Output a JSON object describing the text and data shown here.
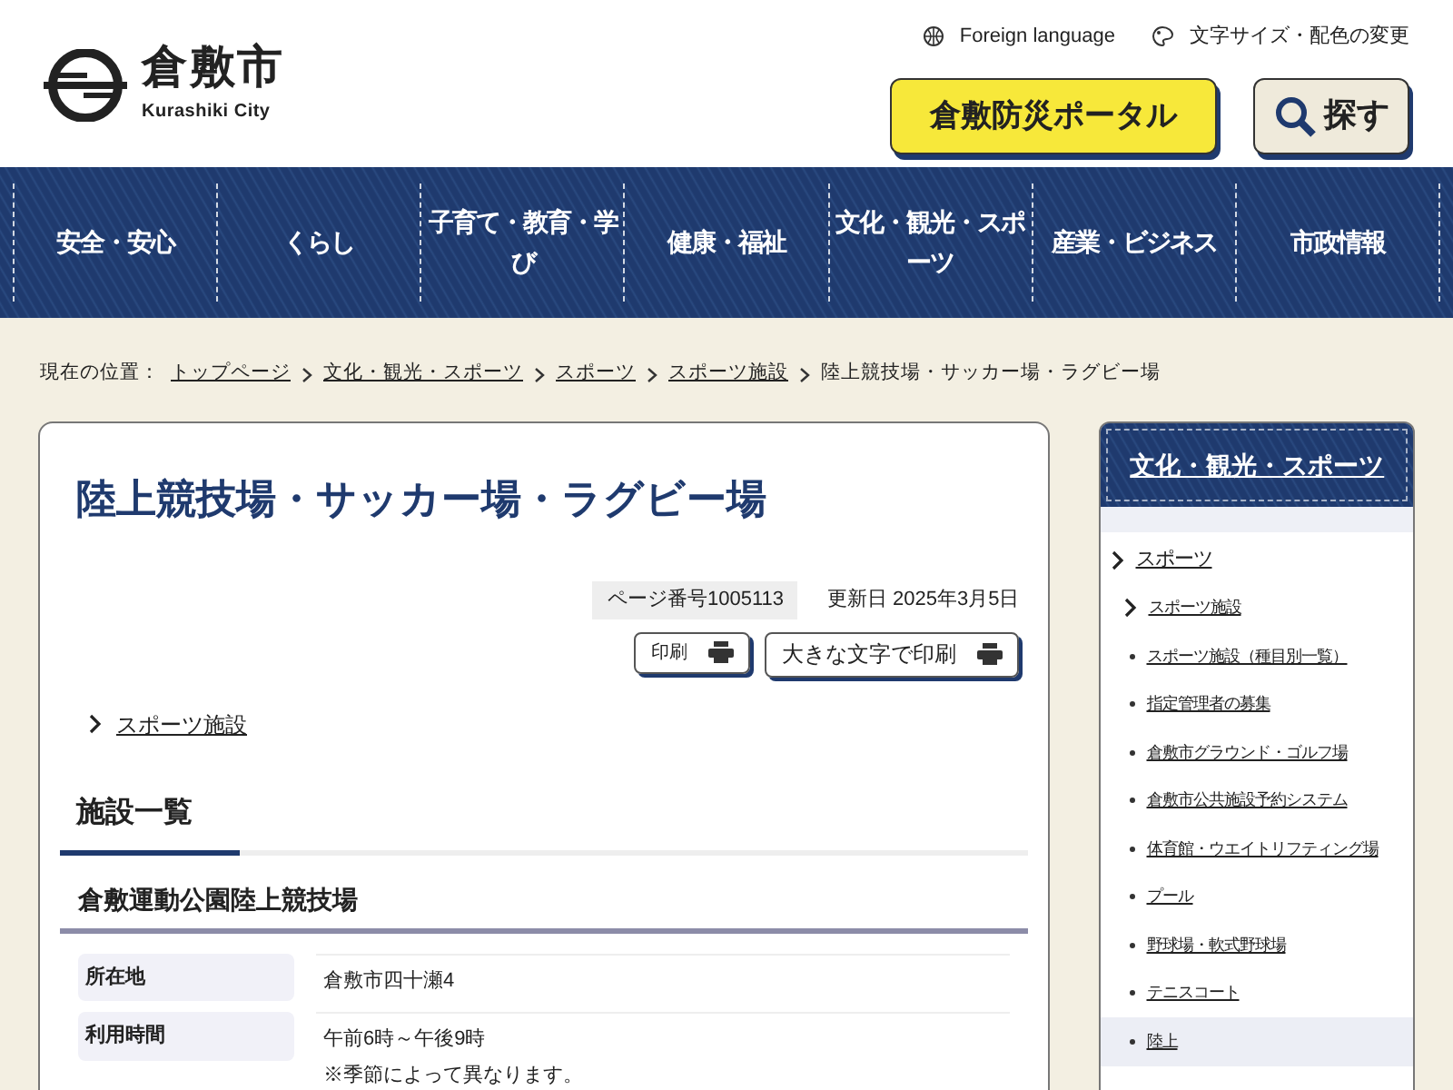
{
  "header": {
    "logo_name": "倉敷市",
    "logo_subtitle": "Kurashiki City",
    "links": [
      {
        "kind": "globe",
        "label": "Foreign language"
      },
      {
        "kind": "palette",
        "label": "文字サイズ・配色の変更"
      }
    ],
    "disaster_button": "倉敷防災ポータル",
    "search_button": "探す"
  },
  "nav": [
    "安全・安心",
    "くらし",
    "子育て・教育・学び",
    "健康・福祉",
    "文化・観光・スポーツ",
    "産業・ビジネス",
    "市政情報"
  ],
  "breadcrumb": {
    "label": "現在の位置：",
    "links": [
      "トップページ",
      "文化・観光・スポーツ",
      "スポーツ",
      "スポーツ施設"
    ],
    "current": "陸上競技場・サッカー場・ラグビー場"
  },
  "article": {
    "title": "陸上競技場・サッカー場・ラグビー場",
    "page_number": "ページ番号1005113",
    "updated": "更新日 2025年3月5日",
    "print_button": "印刷",
    "large_print_button": "大きな文字で印刷",
    "parent_link": "スポーツ施設",
    "section_heading": "施設一覧",
    "facility_heading": "倉敷運動公園陸上競技場",
    "table": [
      {
        "label": "所在地",
        "lines": [
          "倉敷市四十瀬4"
        ]
      },
      {
        "label": "利用時間",
        "lines": [
          "午前6時～午後9時",
          "※季節によって異なります。"
        ]
      }
    ]
  },
  "sidebar": {
    "title": "文化・観光・スポーツ",
    "items": [
      {
        "label": "スポーツ",
        "selected": false,
        "children": [
          {
            "label": "スポーツ施設",
            "selected": false,
            "children": [
              {
                "label": "スポーツ施設（種目別一覧）",
                "selected": false
              },
              {
                "label": "指定管理者の募集",
                "selected": false
              },
              {
                "label": "倉敷市グラウンド・ゴルフ場",
                "selected": false
              },
              {
                "label": "倉敷市公共施設予約システム",
                "selected": false
              },
              {
                "label": "体育館・ウエイトリフティング場",
                "selected": false
              },
              {
                "label": "プール",
                "selected": false
              },
              {
                "label": "野球場・軟式野球場",
                "selected": false
              },
              {
                "label": "テニスコート",
                "selected": false
              },
              {
                "label": "陸上",
                "selected": true
              }
            ]
          }
        ]
      }
    ]
  }
}
